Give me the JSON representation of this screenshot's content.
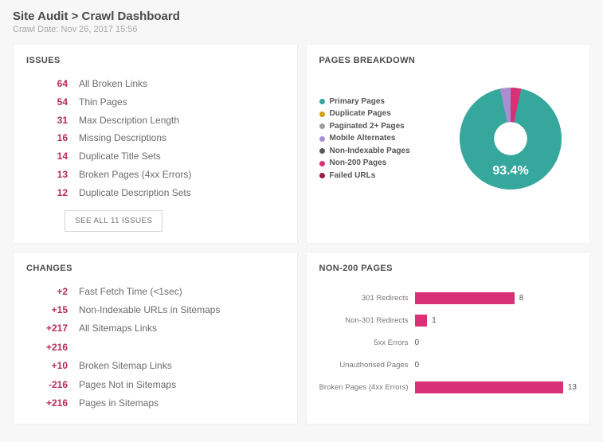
{
  "header": {
    "title": "Site Audit > Crawl Dashboard",
    "subtitle": "Crawl Date: Nov 26, 2017 15:56"
  },
  "issues": {
    "title": "ISSUES",
    "items": [
      {
        "count": "64",
        "label": "All Broken Links"
      },
      {
        "count": "54",
        "label": "Thin Pages"
      },
      {
        "count": "31",
        "label": "Max Description Length"
      },
      {
        "count": "16",
        "label": "Missing Descriptions"
      },
      {
        "count": "14",
        "label": "Duplicate Title Sets"
      },
      {
        "count": "13",
        "label": "Broken Pages (4xx Errors)"
      },
      {
        "count": "12",
        "label": "Duplicate Description Sets"
      }
    ],
    "see_all_label": "SEE ALL 11 ISSUES"
  },
  "changes": {
    "title": "CHANGES",
    "items": [
      {
        "count": "+2",
        "label": "Fast Fetch Time (<1sec)"
      },
      {
        "count": "+15",
        "label": "Non-Indexable URLs in Sitemaps"
      },
      {
        "count": "+217",
        "label": "All Sitemaps Links"
      },
      {
        "count": "+216",
        "label": ""
      },
      {
        "count": "+10",
        "label": "Broken Sitemap Links"
      },
      {
        "count": "-216",
        "label": "Pages Not in Sitemaps"
      },
      {
        "count": "+216",
        "label": "Pages in Sitemaps"
      }
    ]
  },
  "breakdown": {
    "title": "PAGES BREAKDOWN",
    "legend": [
      {
        "label": "Primary Pages",
        "color": "#35a79c"
      },
      {
        "label": "Duplicate Pages",
        "color": "#d6a014"
      },
      {
        "label": "Paginated 2+ Pages",
        "color": "#9e9e9e"
      },
      {
        "label": "Mobile Alternates",
        "color": "#a88fd1"
      },
      {
        "label": "Non-Indexable Pages",
        "color": "#5a5a5a"
      },
      {
        "label": "Non-200 Pages",
        "color": "#d93175"
      },
      {
        "label": "Failed URLs",
        "color": "#9b1c3c"
      }
    ],
    "center_label": "93.4%",
    "colors": {
      "primary": "#35a79c",
      "alternates": "#a88fd1",
      "non200": "#d93175"
    }
  },
  "non200": {
    "title": "NON-200 PAGES"
  },
  "chart_data": [
    {
      "type": "pie",
      "title": "Pages Breakdown",
      "series": [
        {
          "name": "Primary Pages",
          "value": 93.4,
          "color": "#35a79c"
        },
        {
          "name": "Duplicate Pages",
          "value": 0.0,
          "color": "#d6a014"
        },
        {
          "name": "Paginated 2+ Pages",
          "value": 0.0,
          "color": "#9e9e9e"
        },
        {
          "name": "Mobile Alternates",
          "value": 3.3,
          "color": "#a88fd1"
        },
        {
          "name": "Non-Indexable Pages",
          "value": 0.0,
          "color": "#5a5a5a"
        },
        {
          "name": "Non-200 Pages",
          "value": 3.3,
          "color": "#d93175"
        },
        {
          "name": "Failed URLs",
          "value": 0.0,
          "color": "#9b1c3c"
        }
      ]
    },
    {
      "type": "bar",
      "title": "Non-200 Pages",
      "orientation": "horizontal",
      "xlabel": "",
      "ylabel": "",
      "xlim": [
        0,
        13
      ],
      "categories": [
        "301 Redirects",
        "Non-301 Redirects",
        "5xx Errors",
        "Unauthorised Pages",
        "Broken Pages (4xx Errors)"
      ],
      "values": [
        8,
        1,
        0,
        0,
        13
      ],
      "color": "#d93175"
    }
  ]
}
